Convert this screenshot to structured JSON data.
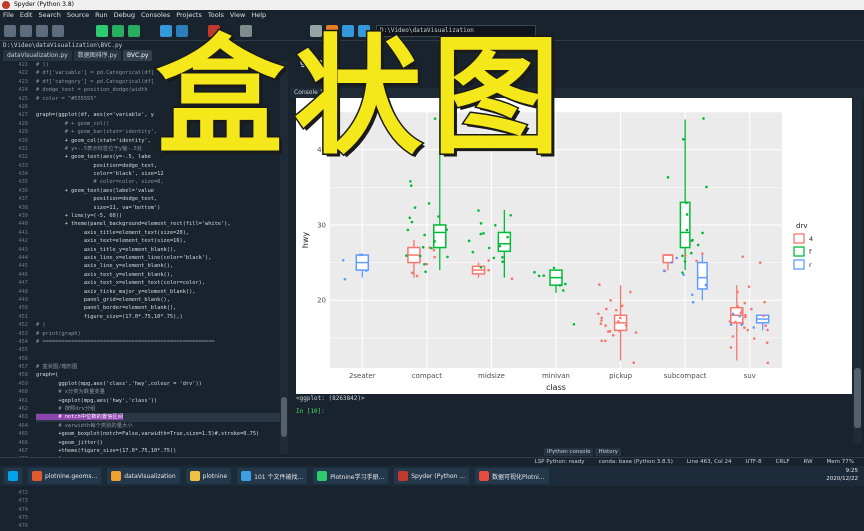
{
  "window": {
    "title": "Spyder (Python 3.8)"
  },
  "menu": [
    "File",
    "Edit",
    "Search",
    "Source",
    "Run",
    "Debug",
    "Consoles",
    "Projects",
    "Tools",
    "View",
    "Help"
  ],
  "toolbar": {
    "path": "D:\\Video\\dataVisualization"
  },
  "editor": {
    "file_path": "D:\\Video\\dataVisualization\\BVC.py",
    "tabs": [
      "dataVisualization.py",
      "数据图排序.py",
      "BVC.py"
    ],
    "active_tab": "BVC.py",
    "lines": [
      {
        "n": "421",
        "t": "# ))"
      },
      {
        "n": "422",
        "t": "# df['variable'] = pd.Categorical(df["
      },
      {
        "n": "423",
        "t": "# df['category'] = pd.Categorical(df["
      },
      {
        "n": "424",
        "t": "# dodge_text = position_dodge(width"
      },
      {
        "n": "425",
        "t": "# color = \"#555555\""
      },
      {
        "n": "426",
        "t": ""
      },
      {
        "n": "427",
        "t": "graph=(ggplot(df, aes(x='variable', y         l='category'))"
      },
      {
        "n": "428",
        "t": "         # + geom_col()"
      },
      {
        "n": "429",
        "t": "         # + geom_bar(stat='identity',"
      },
      {
        "n": "430",
        "t": "         + geom_col(stat='identity',"
      },
      {
        "n": "431",
        "t": "         # y+-.5表示标签位于y轴-.5处"
      },
      {
        "n": "432",
        "t": "         + geom_text(aes(y=-.5, labe"
      },
      {
        "n": "433",
        "t": "                  position=dodge_text,"
      },
      {
        "n": "434",
        "t": "                  color='black', size=12"
      },
      {
        "n": "435",
        "t": "                  # color=color, size=8,"
      },
      {
        "n": "436",
        "t": "         + geom_text(aes(label='value"
      },
      {
        "n": "437",
        "t": "                  position=dodge_text,"
      },
      {
        "n": "438",
        "t": "                  size=11, va='bottom')"
      },
      {
        "n": "439",
        "t": "         + lims(y=(-5, 60))"
      },
      {
        "n": "440",
        "t": "         + theme(panel_background=element_rect(fill='white'),"
      },
      {
        "n": "441",
        "t": "               axis_title=element_text(size=20),"
      },
      {
        "n": "442",
        "t": "               axis_text=element_text(size=16),"
      },
      {
        "n": "443",
        "t": "               axis_title_y=element_blank(),"
      },
      {
        "n": "444",
        "t": "               axis_line_x=element_line(color='black'),"
      },
      {
        "n": "445",
        "t": "               axis_line_y=element_blank(),"
      },
      {
        "n": "446",
        "t": "               axis_text_y=element_blank(),"
      },
      {
        "n": "447",
        "t": "               axis_text_x=element_text(color=color),"
      },
      {
        "n": "448",
        "t": "               axis_ticks_major_y=element_blank(),"
      },
      {
        "n": "449",
        "t": "               panel_grid=element_blank(),"
      },
      {
        "n": "450",
        "t": "               panel_border=element_blank(),"
      },
      {
        "n": "451",
        "t": "               figure_size=(17.0*.75,10*.75),)"
      },
      {
        "n": "452",
        "t": "# )"
      },
      {
        "n": "453",
        "t": "# print(graph)"
      },
      {
        "n": "454",
        "t": "# ======================================================"
      },
      {
        "n": "455",
        "t": ""
      },
      {
        "n": "456",
        "t": ""
      },
      {
        "n": "457",
        "t": "# 盒状图/箱形图"
      },
      {
        "n": "458",
        "t": "graph=("
      },
      {
        "n": "459",
        "t": "       ggplot(mpg,aes('class','hwy',colour = 'drv'))"
      },
      {
        "n": "460",
        "t": "       # x分类为数量变量"
      },
      {
        "n": "461",
        "t": "       +geplot(mpg,aes('hwy','class'))"
      },
      {
        "n": "462",
        "t": "       # 按照drv分组"
      },
      {
        "n": "463",
        "t": "       # notch中位数的置信区间",
        "hl": true
      },
      {
        "n": "464",
        "t": "       # varwidth每个类别的量大小"
      },
      {
        "n": "465",
        "t": "       +geom_boxplot(notch=False,varwidth=True,size=1.5)#,stroke=0.75)"
      },
      {
        "n": "466",
        "t": "       +geom_jitter()"
      },
      {
        "n": "467",
        "t": "       +theme(figure_size=(17.0*.75,10*.75))"
      },
      {
        "n": "468",
        "t": "       )"
      },
      {
        "n": "469",
        "t": ""
      },
      {
        "n": "470",
        "t": "print(graph)"
      },
      {
        "n": "471",
        "t": ""
      },
      {
        "n": "472",
        "t": ""
      },
      {
        "n": "473",
        "t": ""
      },
      {
        "n": "474",
        "t": ""
      },
      {
        "n": "475",
        "t": ""
      },
      {
        "n": "476",
        "t": ""
      }
    ]
  },
  "right_pane": {
    "tab_label": "geom_",
    "console_tabs": [
      "Console 1/A",
      "×"
    ]
  },
  "console": {
    "output": "<ggplot: (8263842)>",
    "prompt": "In [10]:"
  },
  "bottom_tabs": [
    "IPython console",
    "History"
  ],
  "status": [
    "LSP Python: ready",
    "conda: base (Python 3.8.5)",
    "Line 463, Col 24",
    "UTF-8",
    "CRLF",
    "RW",
    "Mem 77%"
  ],
  "taskbar": [
    "plotnine.geoms...",
    "dataVisualization",
    "plotnine",
    "101 个文件被找...",
    "Plotnine学习手册...",
    "Spyder (Python ...",
    "数据可视化Plotni..."
  ],
  "clock": {
    "time": "9:25",
    "date": "2020/12/22"
  },
  "overlay": {
    "text": "盒状图"
  },
  "colors": {
    "bg": "#19232d",
    "f4": "#f8766d",
    "ff": "#00ba38",
    "fr": "#619cff",
    "overlay": "#f5e81a"
  },
  "chart_data": {
    "type": "box",
    "xlabel": "class",
    "ylabel": "hwy",
    "categories": [
      "2seater",
      "compact",
      "midsize",
      "minivan",
      "pickup",
      "subcompact",
      "suv"
    ],
    "yticks": [
      20,
      30,
      40
    ],
    "ylim": [
      11,
      45
    ],
    "legend": {
      "title": "drv",
      "entries": [
        "4",
        "f",
        "r"
      ],
      "placement": "right"
    },
    "boxes": [
      {
        "class": "2seater",
        "drv": "r",
        "q1": 24,
        "median": 25,
        "q3": 26,
        "lo": 23,
        "hi": 26
      },
      {
        "class": "compact",
        "drv": "4",
        "q1": 25,
        "median": 26,
        "q3": 27,
        "lo": 23,
        "hi": 28
      },
      {
        "class": "compact",
        "drv": "f",
        "q1": 27,
        "median": 29,
        "q3": 30,
        "lo": 24,
        "hi": 44
      },
      {
        "class": "midsize",
        "drv": "4",
        "q1": 23.5,
        "median": 24,
        "q3": 24.5,
        "lo": 23,
        "hi": 25
      },
      {
        "class": "midsize",
        "drv": "f",
        "q1": 26.5,
        "median": 27.5,
        "q3": 29,
        "lo": 23,
        "hi": 32
      },
      {
        "class": "minivan",
        "drv": "f",
        "q1": 22,
        "median": 23,
        "q3": 24,
        "lo": 21,
        "hi": 24
      },
      {
        "class": "pickup",
        "drv": "4",
        "q1": 16,
        "median": 17,
        "q3": 18,
        "lo": 12,
        "hi": 22
      },
      {
        "class": "subcompact",
        "drv": "4",
        "q1": 25,
        "median": 26,
        "q3": 26,
        "lo": 24,
        "hi": 26
      },
      {
        "class": "subcompact",
        "drv": "f",
        "q1": 27,
        "median": 29,
        "q3": 33,
        "lo": 24,
        "hi": 44
      },
      {
        "class": "subcompact",
        "drv": "r",
        "q1": 21.5,
        "median": 23,
        "q3": 25,
        "lo": 20,
        "hi": 26
      },
      {
        "class": "suv",
        "drv": "4",
        "q1": 17,
        "median": 18,
        "q3": 19,
        "lo": 12,
        "hi": 22
      },
      {
        "class": "suv",
        "drv": "r",
        "q1": 17,
        "median": 17.5,
        "q3": 18,
        "lo": 16,
        "hi": 18
      }
    ],
    "points": [
      [
        "2seater",
        "r",
        26
      ],
      [
        "2seater",
        "r",
        23
      ],
      [
        "2seater",
        "r",
        26
      ],
      [
        "2seater",
        "r",
        25
      ],
      [
        "2seater",
        "r",
        24
      ],
      [
        "compact",
        "4",
        23
      ],
      [
        "compact",
        "4",
        27
      ],
      [
        "compact",
        "4",
        25
      ],
      [
        "compact",
        "4",
        26
      ],
      [
        "compact",
        "4",
        27
      ],
      [
        "compact",
        "4",
        24
      ],
      [
        "compact",
        "f",
        29
      ],
      [
        "compact",
        "f",
        31
      ],
      [
        "compact",
        "f",
        26
      ],
      [
        "compact",
        "f",
        27
      ],
      [
        "compact",
        "f",
        28
      ],
      [
        "compact",
        "f",
        30
      ],
      [
        "compact",
        "f",
        25
      ],
      [
        "compact",
        "f",
        33
      ],
      [
        "compact",
        "f",
        35
      ],
      [
        "compact",
        "f",
        26
      ],
      [
        "compact",
        "f",
        29
      ],
      [
        "compact",
        "f",
        32
      ],
      [
        "compact",
        "f",
        24
      ],
      [
        "compact",
        "f",
        27
      ],
      [
        "compact",
        "f",
        31
      ],
      [
        "compact",
        "f",
        36
      ],
      [
        "compact",
        "f",
        29
      ],
      [
        "compact",
        "f",
        26
      ],
      [
        "compact",
        "f",
        44
      ],
      [
        "midsize",
        "4",
        23
      ],
      [
        "midsize",
        "4",
        24
      ],
      [
        "midsize",
        "4",
        25
      ],
      [
        "midsize",
        "f",
        27
      ],
      [
        "midsize",
        "f",
        29
      ],
      [
        "midsize",
        "f",
        26
      ],
      [
        "midsize",
        "f",
        30
      ],
      [
        "midsize",
        "f",
        28
      ],
      [
        "midsize",
        "f",
        31
      ],
      [
        "midsize",
        "f",
        25
      ],
      [
        "midsize",
        "f",
        26
      ],
      [
        "midsize",
        "f",
        29
      ],
      [
        "midsize",
        "f",
        32
      ],
      [
        "midsize",
        "f",
        27
      ],
      [
        "midsize",
        "f",
        24
      ],
      [
        "midsize",
        "f",
        28
      ],
      [
        "midsize",
        "f",
        30
      ],
      [
        "midsize",
        "f",
        26
      ],
      [
        "minivan",
        "f",
        24
      ],
      [
        "minivan",
        "f",
        22
      ],
      [
        "minivan",
        "f",
        23
      ],
      [
        "minivan",
        "f",
        17
      ],
      [
        "minivan",
        "f",
        24
      ],
      [
        "minivan",
        "f",
        22
      ],
      [
        "minivan",
        "f",
        21
      ],
      [
        "minivan",
        "f",
        23
      ],
      [
        "pickup",
        "4",
        17
      ],
      [
        "pickup",
        "4",
        15
      ],
      [
        "pickup",
        "4",
        19
      ],
      [
        "pickup",
        "4",
        16
      ],
      [
        "pickup",
        "4",
        18
      ],
      [
        "pickup",
        "4",
        20
      ],
      [
        "pickup",
        "4",
        17
      ],
      [
        "pickup",
        "4",
        16
      ],
      [
        "pickup",
        "4",
        12
      ],
      [
        "pickup",
        "4",
        15
      ],
      [
        "pickup",
        "4",
        17
      ],
      [
        "pickup",
        "4",
        19
      ],
      [
        "pickup",
        "4",
        16
      ],
      [
        "pickup",
        "4",
        18
      ],
      [
        "pickup",
        "4",
        17
      ],
      [
        "pickup",
        "4",
        15
      ],
      [
        "pickup",
        "4",
        21
      ],
      [
        "pickup",
        "4",
        16
      ],
      [
        "pickup",
        "4",
        17
      ],
      [
        "pickup",
        "4",
        18
      ],
      [
        "pickup",
        "4",
        19
      ],
      [
        "pickup",
        "4",
        22
      ],
      [
        "subcompact",
        "f",
        26
      ],
      [
        "subcompact",
        "f",
        29
      ],
      [
        "subcompact",
        "f",
        33
      ],
      [
        "subcompact",
        "f",
        36
      ],
      [
        "subcompact",
        "f",
        28
      ],
      [
        "subcompact",
        "f",
        44
      ],
      [
        "subcompact",
        "f",
        41
      ],
      [
        "subcompact",
        "f",
        29
      ],
      [
        "subcompact",
        "f",
        25
      ],
      [
        "subcompact",
        "f",
        27
      ],
      [
        "subcompact",
        "f",
        31
      ],
      [
        "subcompact",
        "f",
        26
      ],
      [
        "subcompact",
        "f",
        24
      ],
      [
        "subcompact",
        "f",
        35
      ],
      [
        "subcompact",
        "f",
        28
      ],
      [
        "subcompact",
        "4",
        25
      ],
      [
        "subcompact",
        "4",
        26
      ],
      [
        "subcompact",
        "4",
        26
      ],
      [
        "subcompact",
        "4",
        24
      ],
      [
        "subcompact",
        "r",
        23
      ],
      [
        "subcompact",
        "r",
        21
      ],
      [
        "subcompact",
        "r",
        20
      ],
      [
        "subcompact",
        "r",
        25
      ],
      [
        "subcompact",
        "r",
        26
      ],
      [
        "subcompact",
        "r",
        22
      ],
      [
        "subcompact",
        "r",
        24
      ],
      [
        "suv",
        "4",
        17
      ],
      [
        "suv",
        "4",
        19
      ],
      [
        "suv",
        "4",
        18
      ],
      [
        "suv",
        "4",
        15
      ],
      [
        "suv",
        "4",
        20
      ],
      [
        "suv",
        "4",
        17
      ],
      [
        "suv",
        "4",
        16
      ],
      [
        "suv",
        "4",
        14
      ],
      [
        "suv",
        "4",
        22
      ],
      [
        "suv",
        "4",
        18
      ],
      [
        "suv",
        "4",
        19
      ],
      [
        "suv",
        "4",
        17
      ],
      [
        "suv",
        "4",
        16
      ],
      [
        "suv",
        "4",
        12
      ],
      [
        "suv",
        "4",
        18
      ],
      [
        "suv",
        "4",
        20
      ],
      [
        "suv",
        "4",
        15
      ],
      [
        "suv",
        "4",
        17
      ],
      [
        "suv",
        "4",
        19
      ],
      [
        "suv",
        "4",
        26
      ],
      [
        "suv",
        "4",
        25
      ],
      [
        "suv",
        "4",
        21
      ],
      [
        "suv",
        "4",
        14
      ],
      [
        "suv",
        "4",
        16
      ],
      [
        "suv",
        "4",
        18
      ],
      [
        "suv",
        "r",
        17
      ],
      [
        "suv",
        "r",
        18
      ],
      [
        "suv",
        "r",
        16
      ],
      [
        "suv",
        "r",
        18
      ],
      [
        "suv",
        "r",
        17
      ]
    ]
  }
}
